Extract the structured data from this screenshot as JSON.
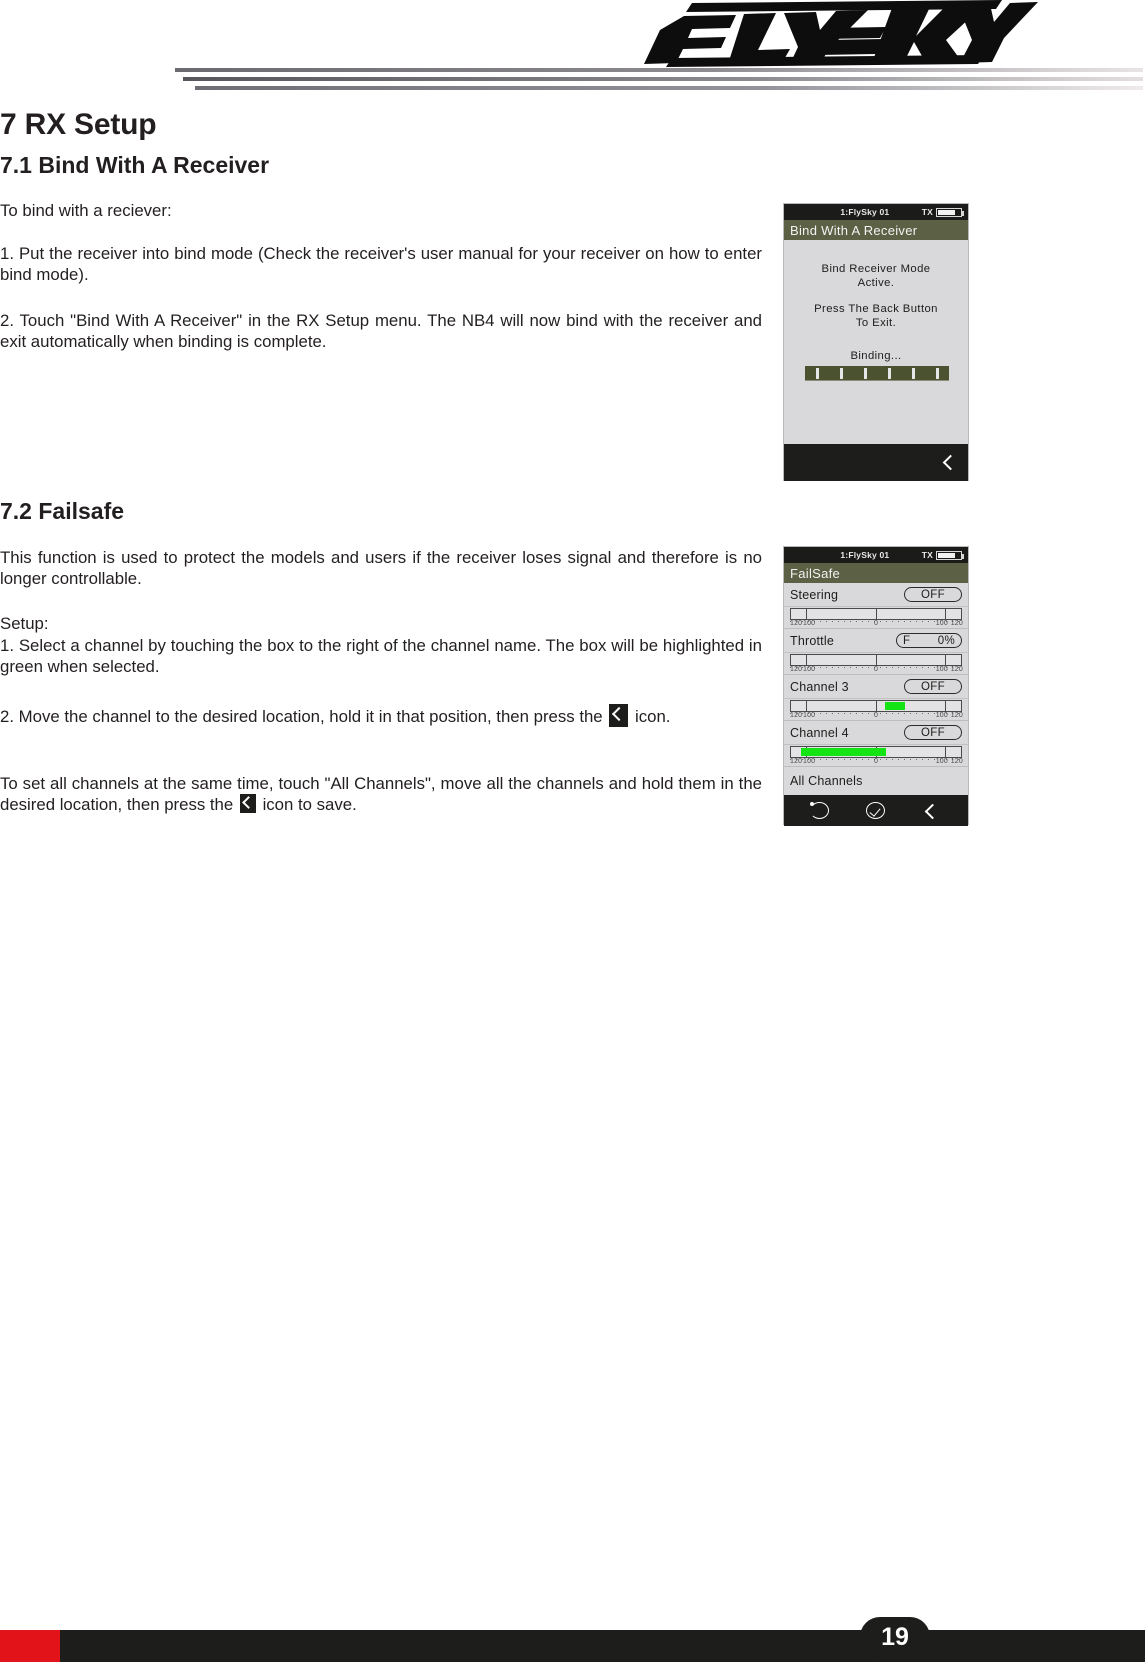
{
  "brand": {
    "logo_text": "FLYSKY"
  },
  "headings": {
    "section": "7 RX Setup",
    "sub1": "7.1 Bind With A Receiver",
    "sub2": "7.2 Failsafe"
  },
  "body": {
    "p1": "To bind with a reciever:",
    "p2": "1. Put the receiver into bind mode (Check the receiver's user manual for your receiver on how to enter bind mode).",
    "p3": "2. Touch \"Bind With A Receiver\" in the RX Setup menu. The NB4 will now bind with the receiver and exit automatically when binding is complete.",
    "p4": "This function is used to protect the models and users if the receiver loses signal and therefore is no longer controllable.",
    "p5": "Setup:",
    "p6": "1. Select a channel by touching the box to the right of the channel name. The box will be highlighted in green when selected.",
    "p7_before": "2. Move the channel to the desired location, hold it in that position, then press the",
    "p7_after": "icon.",
    "p8_before": "To set all channels at the same time, touch \"All Channels\", move all the channels and hold them in the desired location, then press the",
    "p8_after": "icon to save."
  },
  "device_bind": {
    "status_model": "1:FlySky 01",
    "status_tx": "TX",
    "title": "Bind With A Receiver",
    "line1": "Bind Receiver Mode",
    "line2": "Active.",
    "line3": "Press The Back Button",
    "line4": "To Exit.",
    "line5": "Binding...",
    "progress_segments": 6,
    "colors": {
      "titlebar": "#5c6145",
      "progress": "#4b5230",
      "body": "#d9d9dc"
    }
  },
  "device_failsafe": {
    "status_model": "1:FlySky 01",
    "status_tx": "TX",
    "title": "FailSafe",
    "rows": [
      {
        "name": "Steering",
        "value": "OFF",
        "dual": false,
        "bar_left_pct": 0,
        "bar_width_pct": 0
      },
      {
        "name": "Throttle",
        "value": "F",
        "value2": "0%",
        "dual": true,
        "bar_left_pct": 0,
        "bar_width_pct": 0
      },
      {
        "name": "Channel 3",
        "value": "OFF",
        "dual": false,
        "bar_left_pct": 55,
        "bar_width_pct": 12
      },
      {
        "name": "Channel 4",
        "value": "OFF",
        "dual": false,
        "bar_left_pct": 6,
        "bar_width_pct": 50
      }
    ],
    "scale_labels": {
      "left_outer": "120",
      "left_inner": "100",
      "center": "0",
      "right_inner": "100",
      "right_outer": "120"
    },
    "all_channels": "All Channels",
    "nav_icons": [
      "reset-icon",
      "confirm-check-icon",
      "back-arrow-icon"
    ],
    "colors": {
      "titlebar": "#5c6145",
      "bar_green": "#14e414",
      "body": "#d9d9dc"
    }
  },
  "footer": {
    "page_number": "19",
    "accent_color": "#e3131a",
    "bar_color": "#1d1d1b"
  }
}
